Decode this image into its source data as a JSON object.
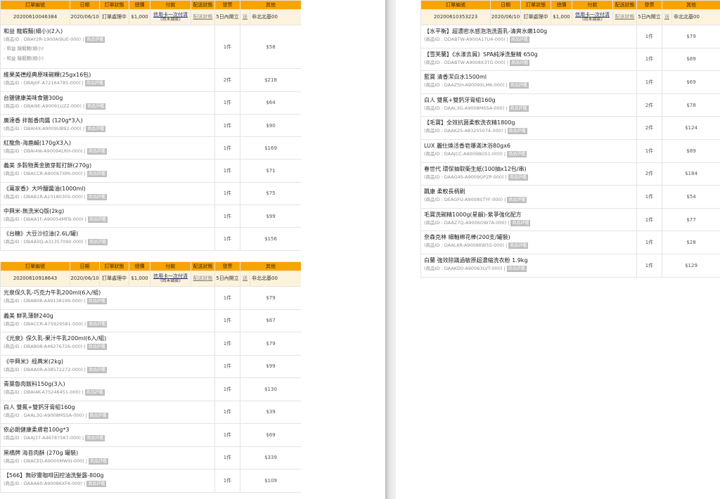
{
  "headers": [
    "訂單編號",
    "日期",
    "訂單狀態",
    "總價",
    "付款",
    "配送狀態",
    "發票",
    "其他"
  ],
  "left_orders": [
    {
      "order": {
        "id": "20200610046384",
        "date": "2020/06/10",
        "status": "訂單處理中",
        "total": "$1,000",
        "pay_main": "信用卡一次付清",
        "pay_sub": "(尚未請款)",
        "ship": "配送狀態",
        "invoice": "5日內開立",
        "other": "送",
        "region": "非北北基00"
      },
      "items": [
        {
          "name": "和益 龍蝦麵(細小)(2入)",
          "meta": "(商品ID : DBAY2R-1900AI9UE-000) |",
          "badge": "商品評鑑",
          "qty": "1件",
          "price": "$58",
          "subs": [
            "- 和益 龍蝦麵(細小)",
            "- 和益 龍蝦麵(細小)"
          ]
        },
        {
          "name": "維果美德經典原味碗粿(25gx16包)",
          "meta": "(商品ID : DBAJ0F-A72164785-000) |",
          "badge": "商品評鑑",
          "qty": "2件",
          "price": "$218"
        },
        {
          "name": "台鹽健康美味食鹽300g",
          "meta": "(商品ID : DBAI9E-A90091UZZ-000) |",
          "badge": "商品評鑑",
          "qty": "1件",
          "price": "$64"
        },
        {
          "name": "廣達香 拌飯香肉醬 (120g*3入)",
          "meta": "(商品ID : DBAI4X-A9009UB92-000) |",
          "badge": "商品評鑑",
          "qty": "1件",
          "price": "$90"
        },
        {
          "name": "紅龍魚-海鹿鹹(170gX3入)",
          "meta": "(商品ID : DBAI4W-A90094LRH-000) |",
          "badge": "商品評鑑",
          "qty": "1件",
          "price": "$169"
        },
        {
          "name": "義美 多穀物黃金脆芽鬆打餅(270g)",
          "meta": "(商品ID : DBACCR-A90067XMI-000) |",
          "badge": "商品評鑑",
          "qty": "1件",
          "price": "$71"
        },
        {
          "name": "《萬家香》大吟釀醬油(1000ml)",
          "meta": "(商品ID : DBAB1R-A23180305-000) |",
          "badge": "商品評鑑",
          "qty": "1件",
          "price": "$75"
        },
        {
          "name": "中興米-無洗米Q版(2kg)",
          "meta": "(商品ID : DBAA1F-A90054MFB-000) |",
          "badge": "商品評鑑",
          "qty": "1件",
          "price": "$99"
        },
        {
          "name": "《台糖》大豆沙拉油(2.6L/罐)",
          "meta": "(商品ID : DBAA0Q-A31357090-000) |",
          "badge": "商品評鑑",
          "qty": "1件",
          "price": "$156"
        }
      ]
    },
    {
      "order": {
        "id": "20200610918643",
        "date": "2020/06/10",
        "status": "訂單處理中",
        "total": "$1,000",
        "pay_main": "信用卡一次付清",
        "pay_sub": "(尚未請款)",
        "ship": "配送狀態",
        "invoice": "5日內開立",
        "other": "送",
        "region": "非北北基00"
      },
      "items": [
        {
          "name": "光泉保久乳-巧克力牛乳200ml(6入/組)",
          "meta": "(商品ID : DBAB08-A49138199-000) |",
          "badge": "商品評鑑",
          "qty": "1件",
          "price": "$79"
        },
        {
          "name": "義美 鮮乳薄餅240g",
          "meta": "(商品ID : DBACCR-A75929581-000) |",
          "badge": "商品評鑑",
          "qty": "1件",
          "price": "$67"
        },
        {
          "name": "《光泉》保久乳-果汁牛乳200ml(6入/組)",
          "meta": "(商品ID : DBAB08-A46276726-000) |",
          "badge": "商品評鑑",
          "qty": "1件",
          "price": "$79"
        },
        {
          "name": "《中興米》經典米(2kg)",
          "meta": "(商品ID : DBAA0R-A38572272-000) |",
          "badge": "商品評鑑",
          "qty": "1件",
          "price": "$99"
        },
        {
          "name": "青葉魯肉飯料150g(3入)",
          "meta": "(商品ID : DBAI4K-A75246451-000) |",
          "badge": "商品評鑑",
          "qty": "1件",
          "price": "$130"
        },
        {
          "name": "白人 雙氟+雙鈣牙膏組160g",
          "meta": "(商品ID : DAAL3G-A9008MSSA-000) |",
          "badge": "商品評鑑",
          "qty": "1件",
          "price": "$39"
        },
        {
          "name": "依必朗健康柔膚皂100g*3",
          "meta": "(商品ID : DAAJ37-A46787587-000) |",
          "badge": "商品評鑑",
          "qty": "1件",
          "price": "$69"
        },
        {
          "name": "黑橋牌 海苔肉酥 (270g 罐裝)",
          "meta": "(商品ID : DBACED-A9005MWSI-000) |",
          "badge": "商品評鑑",
          "qty": "1件",
          "price": "$339"
        },
        {
          "name": "【566】無矽靈咖啡因控油洗髮露-800g",
          "meta": "(商品ID : DAAA60-A90086XFK-000) |",
          "badge": "商品評鑑",
          "qty": "1件",
          "price": "$109"
        }
      ]
    }
  ],
  "right_order": {
    "order": {
      "id": "20200610353223",
      "date": "2020/06/10",
      "status": "訂單處理中",
      "total": "$1,000",
      "pay_main": "信用卡一次付清",
      "pay_sub": "(尚未請款)",
      "ship": "配送狀態",
      "invoice": "5日內開立",
      "other": "送",
      "region": "非北北基00"
    },
    "items": [
      {
        "name": "【水平衡】超濃密水感泡泡洗面乳-清爽水嫩100g",
        "meta": "(商品ID : DDABTW-A900A1TU4-000) |",
        "badge": "商品評鑑",
        "qty": "1件",
        "price": "$79"
      },
      {
        "name": "【雪芙蘭】《水漾去屑》SPA純淨洗髮精 650g",
        "meta": "(商品ID : DDABTW-A9008X3TG-000) |",
        "badge": "商品評鑑",
        "qty": "1件",
        "price": "$89"
      },
      {
        "name": "藍寶 清香潔白水1500ml",
        "meta": "(商品ID : DAAZSH-A9009XLM6-000) |",
        "badge": "商品評鑑",
        "qty": "1件",
        "price": "$69"
      },
      {
        "name": "白人 雙氟+雙鈣牙膏組160g",
        "meta": "(商品ID : DAAL3G-A9008MSSA-000) |",
        "badge": "商品評鑑",
        "qty": "2件",
        "price": "$78"
      },
      {
        "name": "【毛寶】全效抗菌柔軟洗衣精1800g",
        "meta": "(商品ID : DAAK25-A83255074-000) |",
        "badge": "商品評鑑",
        "qty": "2件",
        "price": "$124"
      },
      {
        "name": "LUX 麗仕煥活香皂爆滿沐浴80gx6",
        "meta": "(商品ID : DAAJCC-A9009BGS1-000) |",
        "badge": "商品評鑑",
        "qty": "1件",
        "price": "$89"
      },
      {
        "name": "春世代 環保抽取衛生紙(100抽x12包/串)",
        "meta": "(商品ID : DAAG4S-A9009GPZP-000) |",
        "badge": "商品評鑑",
        "qty": "2件",
        "price": "$184"
      },
      {
        "name": "飄康 柔軟長柄刷",
        "meta": "(商品ID : DEAGFU-A9008STYF-000) |",
        "badge": "商品評鑑",
        "qty": "1件",
        "price": "$54"
      },
      {
        "name": "毛寶洗碗精1000g(星韻)-紫爭強化配方",
        "meta": "(商品ID : DAAZ7Q-A9006OW7A-000) |",
        "badge": "商品評鑑",
        "qty": "1件",
        "price": "$77"
      },
      {
        "name": "奈森克林 細軸棉花棒(200支/罐裝)",
        "meta": "(商品ID : DAAL6R-A9008KW55-000) |",
        "badge": "商品評鑑",
        "qty": "1件",
        "price": "$28"
      },
      {
        "name": "白蘭 強效除蹣過敏原超濃縮洗衣粉 1.9kg",
        "meta": "(商品ID : DAAKD0-A90063LVT-000) |",
        "badge": "商品評鑑",
        "qty": "1件",
        "price": "$129"
      }
    ]
  }
}
